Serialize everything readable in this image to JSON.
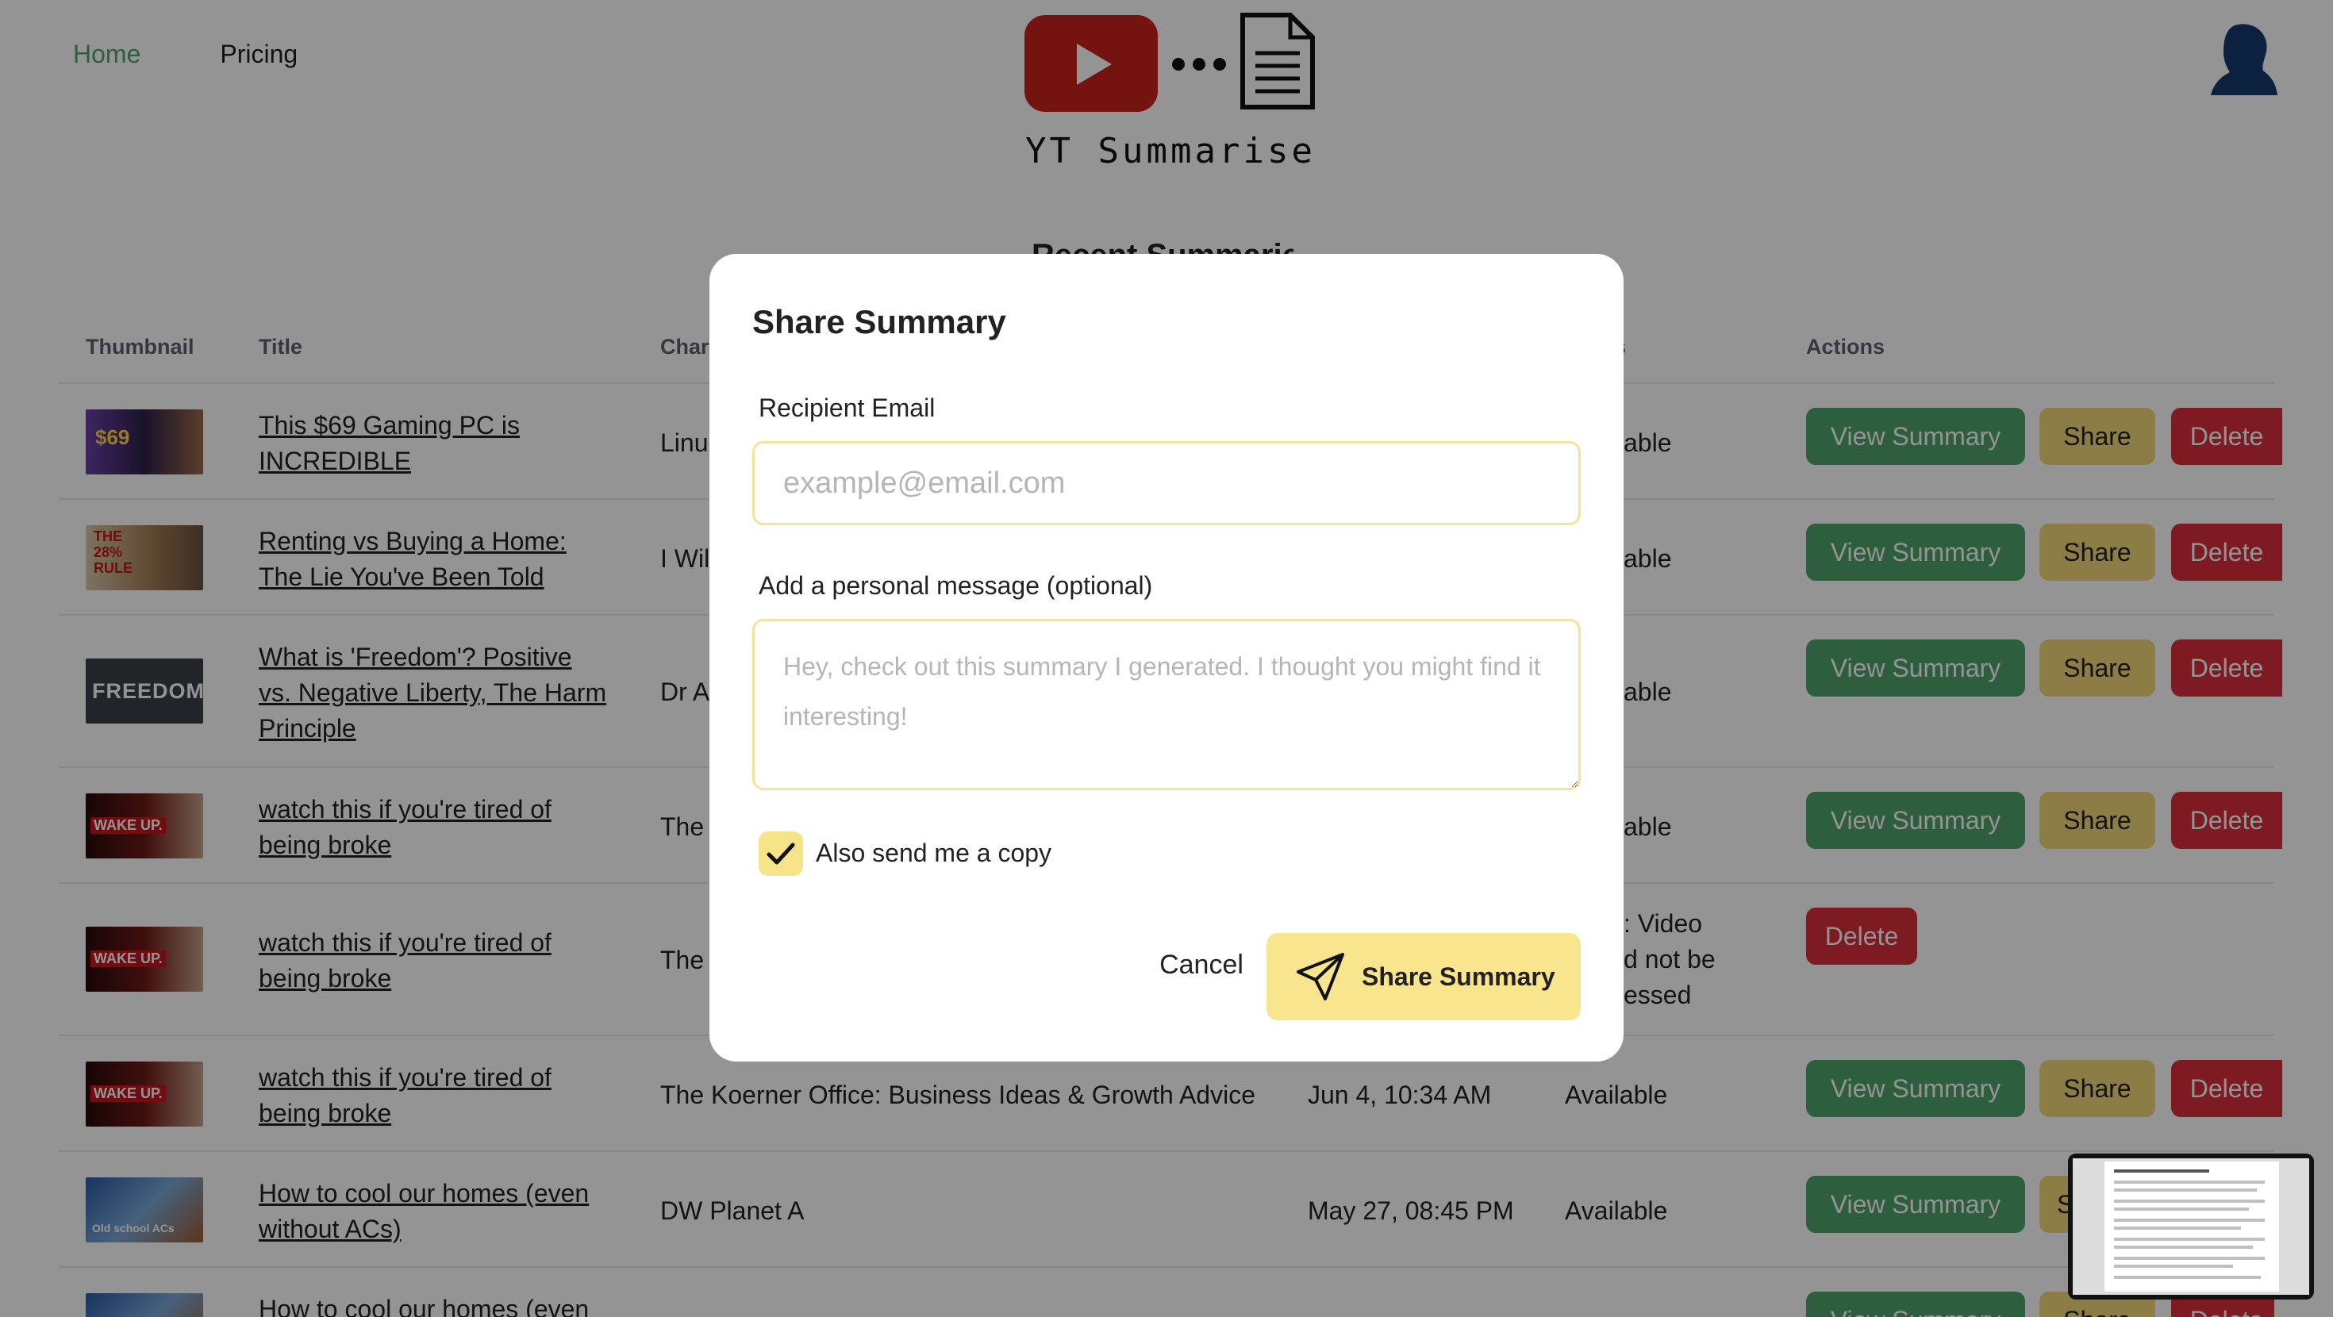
{
  "nav": {
    "home": "Home",
    "pricing": "Pricing"
  },
  "logo": {
    "text": "YT Summarise"
  },
  "section_title": "Recent Summaries",
  "table": {
    "headers": {
      "thumbnail": "Thumbnail",
      "title": "Title",
      "channel": "Char",
      "status": "s",
      "actions": "Actions"
    },
    "rows": [
      {
        "thumb_text": "$69",
        "title": "This $69 Gaming PC is INCREDIBLE",
        "channel": "Linu",
        "date": "",
        "status": "able",
        "view": "View Summary",
        "share": "Share",
        "delete": "Delete"
      },
      {
        "thumb_text": "THE 28% RULE",
        "title": "Renting vs Buying a Home: The Lie You've Been Told",
        "channel": "I Will",
        "date": "",
        "status": "able",
        "view": "View Summary",
        "share": "Share",
        "delete": "Delete"
      },
      {
        "thumb_text": "FREEDOM",
        "title": "What is 'Freedom'? Positive vs. Negative Liberty, The Harm Principle",
        "channel": "Dr Ai",
        "date": "",
        "status": "able",
        "view": "View Summary",
        "share": "Share",
        "delete": "Delete"
      },
      {
        "thumb_text": "WAKE UP.",
        "title": "watch this if you're tired of being broke",
        "channel": "The",
        "date": "",
        "status": "able",
        "view": "View Summary",
        "share": "Share",
        "delete": "Delete"
      },
      {
        "thumb_text": "WAKE UP.",
        "title": "watch this if you're tired of being broke",
        "channel": "The",
        "date": "",
        "status": ": Video\nd not be\nessed",
        "view": "",
        "share": "",
        "delete": "Delete"
      },
      {
        "thumb_text": "WAKE UP.",
        "title": "watch this if you're tired of being broke",
        "channel": "The Koerner Office: Business Ideas & Growth Advice",
        "date": "Jun 4, 10:34 AM",
        "status": "Available",
        "view": "View Summary",
        "share": "Share",
        "delete": "Delete"
      },
      {
        "thumb_text": "Old school ACs",
        "title": "How to cool our homes (even without ACs)",
        "channel": "DW Planet A",
        "date": "May 27, 08:45 PM",
        "status": "Available",
        "view": "View Summary",
        "share": "S",
        "delete": ""
      },
      {
        "thumb_text": "",
        "title": "How to cool our homes (even",
        "channel": "",
        "date": "",
        "status": "",
        "view": "View Summary",
        "share": "Share",
        "delete": "Delete"
      }
    ]
  },
  "modal": {
    "title": "Share Summary",
    "email_label": "Recipient Email",
    "email_placeholder": "example@email.com",
    "message_label": "Add a personal message (optional)",
    "message_placeholder": "Hey, check out this summary I generated. I thought you might find it interesting!",
    "copy_label": "Also send me a copy",
    "copy_checked": true,
    "cancel": "Cancel",
    "submit": "Share Summary"
  },
  "colors": {
    "accent_green": "#4fa46b",
    "accent_yellow": "#f8e58d",
    "delete_red": "#d9303c"
  }
}
